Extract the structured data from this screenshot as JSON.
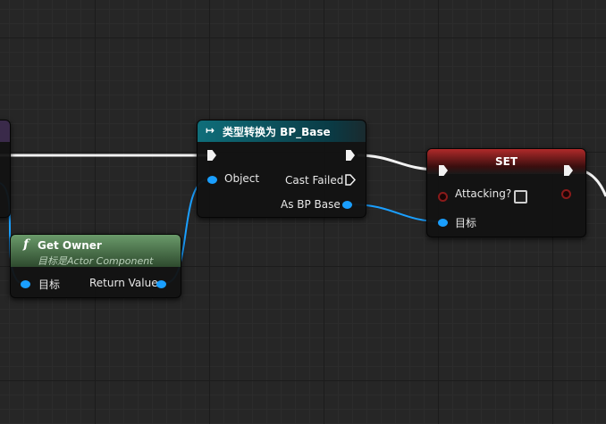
{
  "cast_node": {
    "title": "类型转换为 BP_Base",
    "object_label": "Object",
    "cast_failed_label": "Cast Failed",
    "as_bp_base_label": "As BP Base"
  },
  "get_owner_node": {
    "title": "Get Owner",
    "subtitle": "目标是Actor Component",
    "target_label": "目标",
    "return_value_label": "Return Value"
  },
  "set_node": {
    "title": "SET",
    "attacking_label": "Attacking?",
    "target_label": "目标"
  },
  "colors": {
    "exec_wire": "#f2f2f2",
    "object_wire": "#1a9fff",
    "bool_pin": "#8a1a1a",
    "cast_header": "#0e5e6a",
    "function_header": "#4e7a4e",
    "set_header": "#7a1a1a"
  },
  "icons": {
    "cast": "cast-arrows-icon",
    "function": "function-f-icon"
  }
}
